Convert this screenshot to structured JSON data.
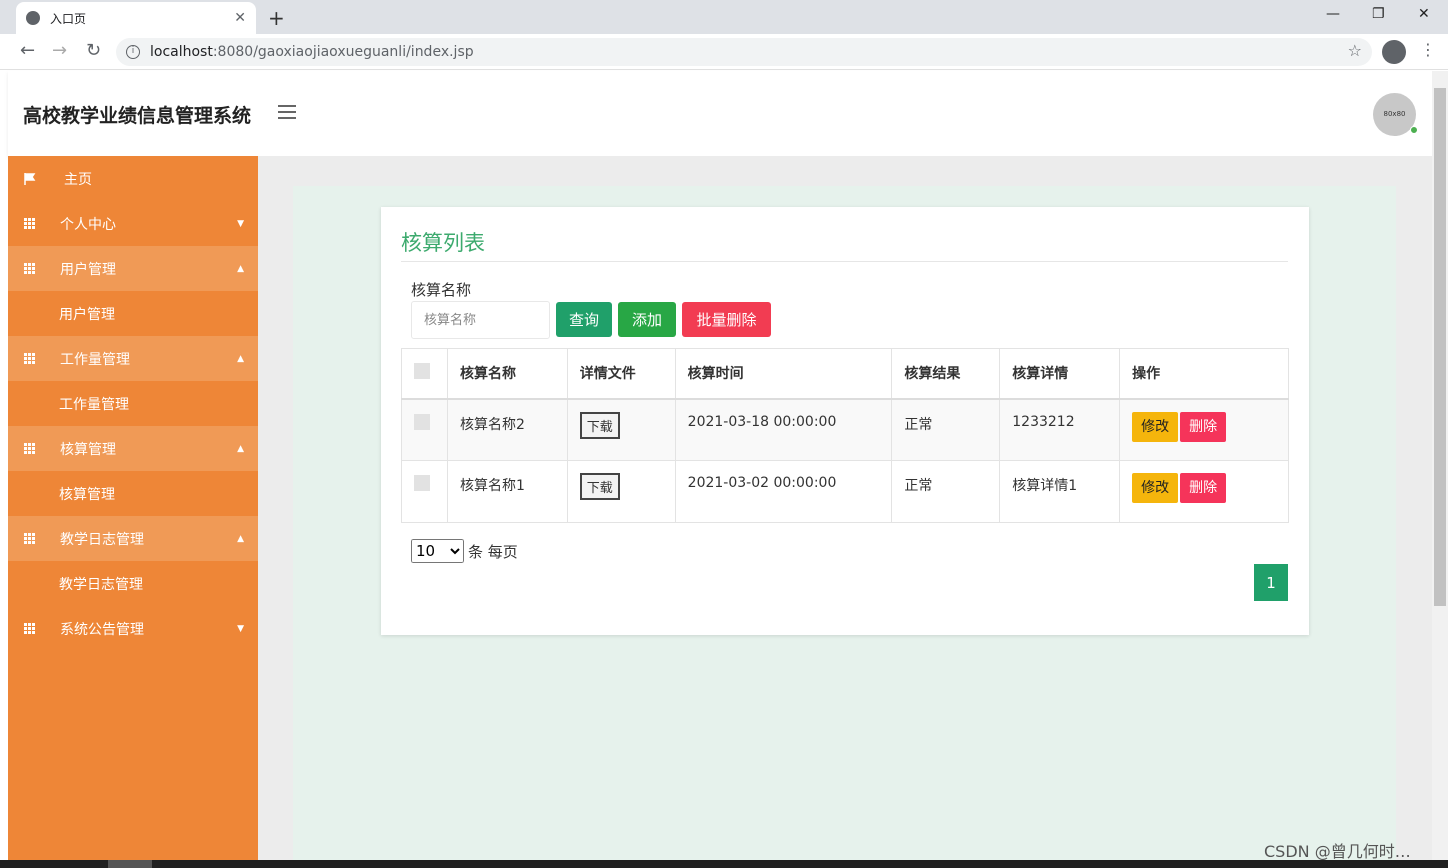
{
  "browser": {
    "tab_title": "入口页",
    "tab_close": "✕",
    "new_tab": "+",
    "url_host": "localhost",
    "url_rest": ":8080/gaoxiaojiaoxueguanli/index.jsp",
    "win_minimize": "—",
    "win_restore": "❐",
    "win_close": "✕"
  },
  "header": {
    "title": "高校教学业绩信息管理系统",
    "avatar_text": "80x80"
  },
  "sidebar": {
    "items": [
      {
        "label": "主页",
        "icon": "flag-icon",
        "caret": ""
      },
      {
        "label": "个人中心",
        "icon": "grid-icon",
        "caret": "▼"
      },
      {
        "label": "用户管理",
        "icon": "grid-icon",
        "caret": "▲",
        "sub": "用户管理"
      },
      {
        "label": "工作量管理",
        "icon": "grid-icon",
        "caret": "▲",
        "sub": "工作量管理"
      },
      {
        "label": "核算管理",
        "icon": "grid-icon",
        "caret": "▲",
        "sub": "核算管理"
      },
      {
        "label": "教学日志管理",
        "icon": "grid-icon",
        "caret": "▲",
        "sub": "教学日志管理"
      },
      {
        "label": "系统公告管理",
        "icon": "grid-icon",
        "caret": "▼"
      }
    ]
  },
  "main": {
    "card_title": "核算列表",
    "search_label": "核算名称",
    "search_placeholder": "核算名称",
    "btn_query": "查询",
    "btn_add": "添加",
    "btn_batch_delete": "批量删除",
    "table": {
      "headers": [
        "",
        "核算名称",
        "详情文件",
        "核算时间",
        "核算结果",
        "核算详情",
        "操作"
      ],
      "rows": [
        {
          "name": "核算名称2",
          "file": "下载",
          "time": "2021-03-18 00:00:00",
          "result": "正常",
          "detail": "1233212",
          "edit": "修改",
          "delete": "删除"
        },
        {
          "name": "核算名称1",
          "file": "下载",
          "time": "2021-03-02 00:00:00",
          "result": "正常",
          "detail": "核算详情1",
          "edit": "修改",
          "delete": "删除"
        }
      ]
    },
    "page_size": "10",
    "page_size_suffix": "条 每页",
    "current_page": "1"
  },
  "watermark": "CSDN @曾几何时…",
  "colors": {
    "sidebar": "#ee8637",
    "accent_green": "#20a06a",
    "title_green": "#3daa6e",
    "danger": "#f23c52",
    "warning": "#f5b50c"
  }
}
